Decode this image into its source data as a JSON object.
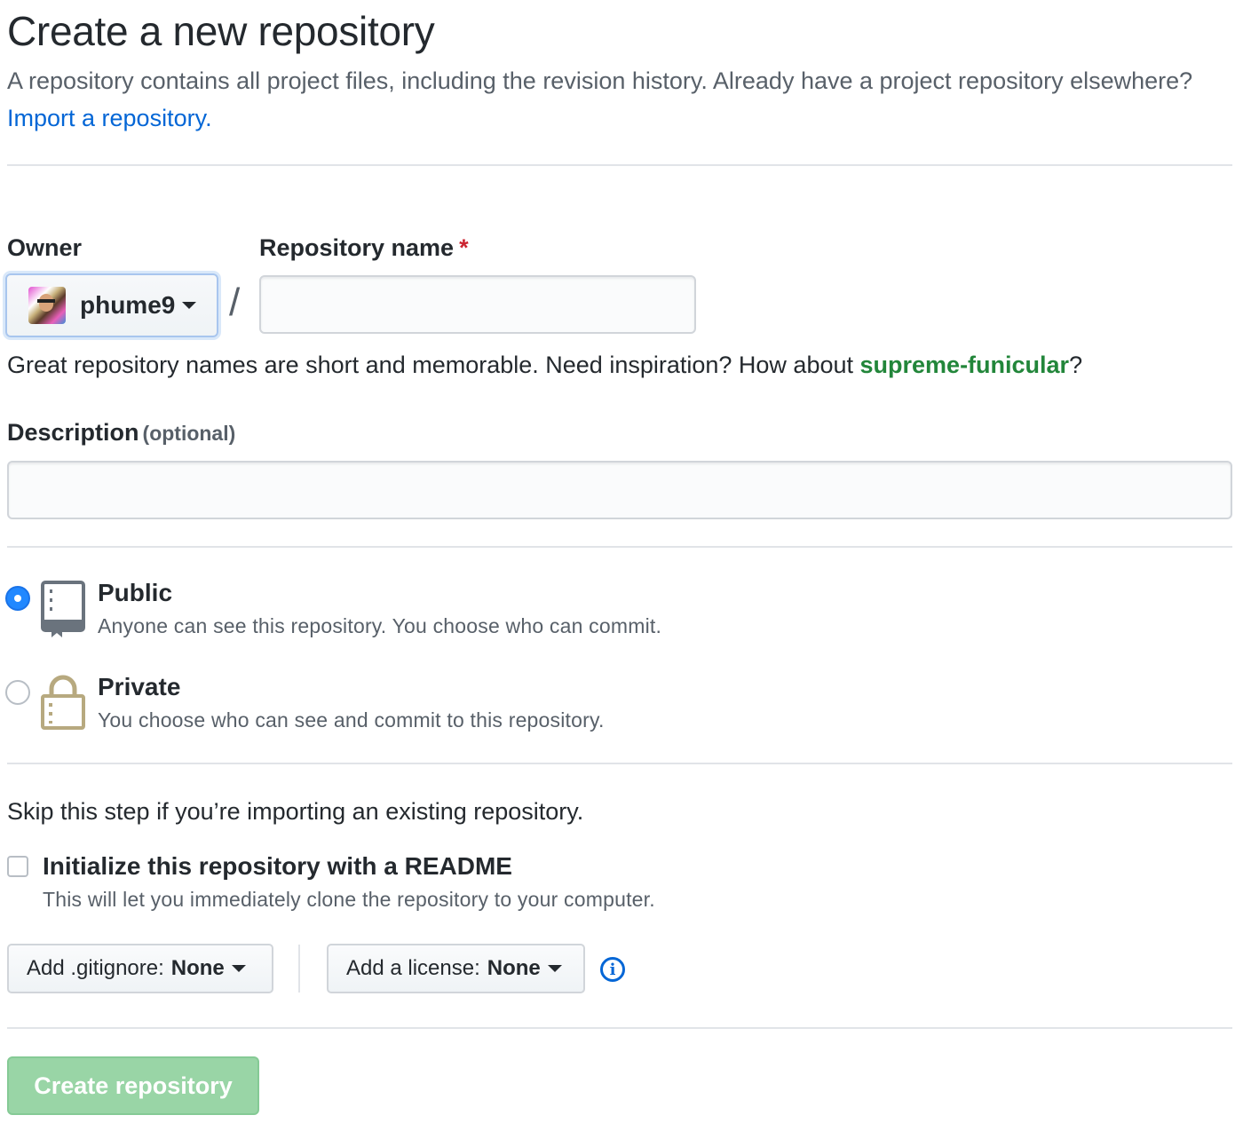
{
  "header": {
    "title": "Create a new repository",
    "subtitle": "A repository contains all project files, including the revision history. Already have a project repository elsewhere?",
    "import_link": "Import a repository."
  },
  "owner": {
    "label": "Owner",
    "selected": "phume9",
    "avatar_icon": "user-avatar",
    "separator": "/"
  },
  "repo_name": {
    "label": "Repository name",
    "required_marker": "*",
    "value": "",
    "placeholder": "",
    "hint_prefix": "Great repository names are short and memorable. Need inspiration? How about",
    "suggestion": "supreme-funicular",
    "hint_suffix": "?"
  },
  "description": {
    "label": "Description",
    "optional_note": "(optional)",
    "value": "",
    "placeholder": ""
  },
  "visibility": {
    "selected": "public",
    "options": [
      {
        "id": "public",
        "title": "Public",
        "description": "Anyone can see this repository. You choose who can commit.",
        "icon": "repo-book-icon"
      },
      {
        "id": "private",
        "title": "Private",
        "description": "You choose who can see and commit to this repository.",
        "icon": "lock-icon"
      }
    ]
  },
  "init": {
    "skip_text": "Skip this step if you’re importing an existing repository.",
    "readme_label": "Initialize this repository with a README",
    "readme_desc": "This will let you immediately clone the repository to your computer.",
    "readme_checked": false,
    "gitignore_label": "Add .gitignore:",
    "gitignore_value": "None",
    "license_label": "Add a license:",
    "license_value": "None",
    "info_icon": "info-icon",
    "info_glyph": "i"
  },
  "submit": {
    "label": "Create repository",
    "disabled": true
  },
  "colors": {
    "link": "#0366d6",
    "suggestion": "#22863a",
    "required": "#cb2431",
    "radio_checked": "#2188ff",
    "create_button": "#94d3a2",
    "lock": "#b7a97f"
  }
}
